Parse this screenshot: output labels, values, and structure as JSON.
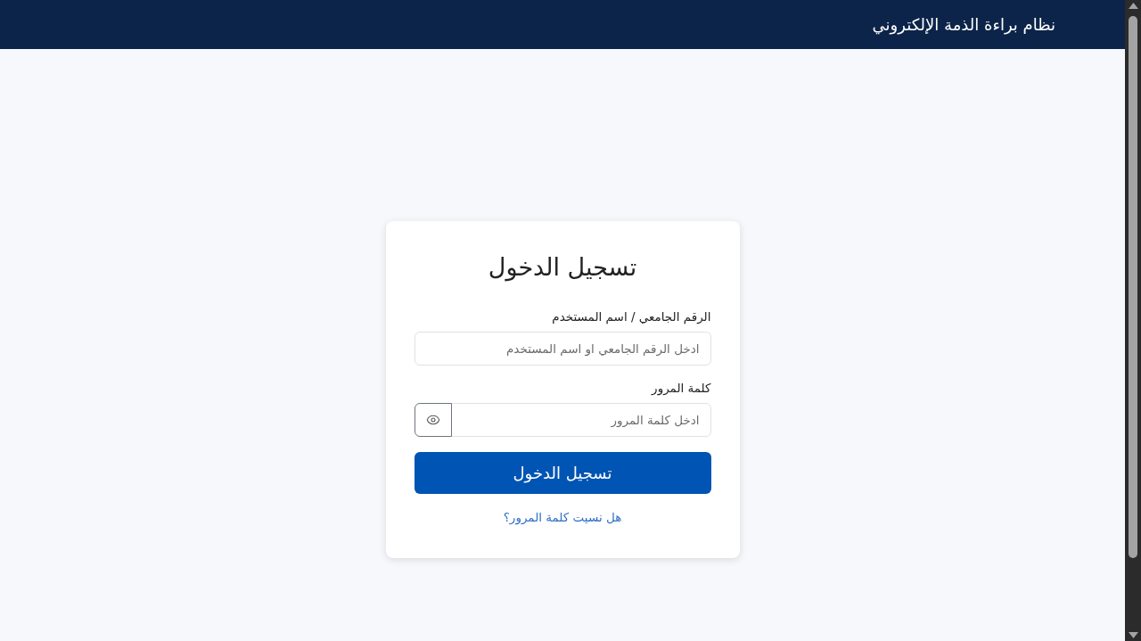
{
  "header": {
    "title": "نظام براءة الذمة الإلكتروني"
  },
  "login_card": {
    "title": "تسجيل الدخول",
    "fields": [
      {
        "kind": "text",
        "label": "الرقم الجامعي / اسم المستخدم",
        "placeholder": "ادخل الرقم الجامعي او اسم المستخدم"
      },
      {
        "kind": "password",
        "label": "كلمة المرور",
        "placeholder": "ادخل كلمة المرور"
      }
    ],
    "submit_button": "تسجيل الدخول",
    "forgot_password_link": "هل نسيت كلمة المرور؟"
  }
}
